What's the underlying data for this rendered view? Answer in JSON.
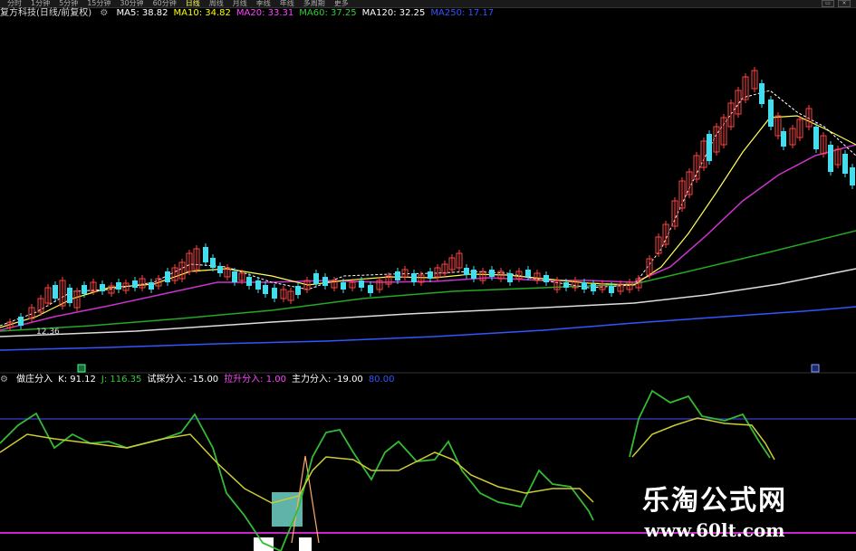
{
  "toolbar": {
    "tabs": [
      "分时",
      "1分钟",
      "5分钟",
      "15分钟",
      "30分钟",
      "60分钟",
      "日线",
      "周线",
      "月线",
      "季线",
      "年线",
      "多周期",
      "更多"
    ],
    "active_index": 6
  },
  "main": {
    "title": "复方科技(日线/前复权)",
    "ma": [
      {
        "label": "MA5: 38.82",
        "color": "#ffffff"
      },
      {
        "label": "MA10: 34.82",
        "color": "#ffff00"
      },
      {
        "label": "MA20: 33.31",
        "color": "#ff44ff"
      },
      {
        "label": "MA60: 37.25",
        "color": "#33cc33"
      },
      {
        "label": "MA120: 32.25",
        "color": "#ffffff"
      },
      {
        "label": "MA250: 17.17",
        "color": "#3355ff"
      }
    ],
    "low_price_label": "12.36"
  },
  "indicator": {
    "items": [
      {
        "label": "做庄分入",
        "color": "#ffffff"
      },
      {
        "label": "K: 91.12",
        "color": "#ffffff"
      },
      {
        "label": "J: 116.35",
        "color": "#33cc33"
      },
      {
        "label": "试探分入: -15.00",
        "color": "#ffffff"
      },
      {
        "label": "拉升分入: 1.00",
        "color": "#ff44ff"
      },
      {
        "label": "主力分入: -19.00",
        "color": "#ffffff"
      },
      {
        "label": "80.00",
        "color": "#3355ff"
      }
    ]
  },
  "watermark": {
    "line1": "乐淘公式网",
    "line2": "www.60lt.com"
  }
}
